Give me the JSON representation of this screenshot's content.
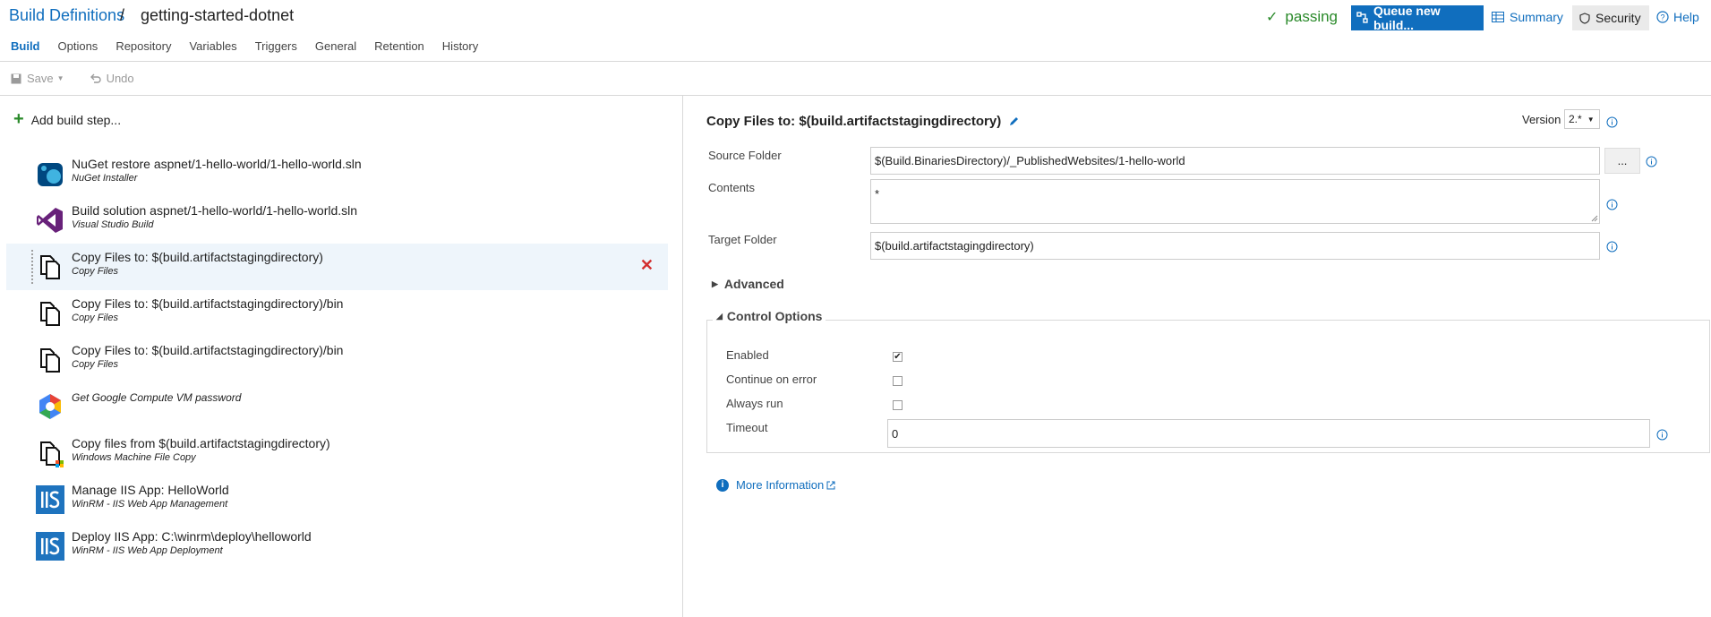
{
  "breadcrumb": {
    "root": "Build Definitions",
    "separator": "/",
    "current": "getting-started-dotnet"
  },
  "header": {
    "status": "passing",
    "queue_button": "Queue new build...",
    "summary": "Summary",
    "security": "Security",
    "help": "Help"
  },
  "tabs": [
    {
      "label": "Build",
      "active": true
    },
    {
      "label": "Options"
    },
    {
      "label": "Repository"
    },
    {
      "label": "Variables"
    },
    {
      "label": "Triggers"
    },
    {
      "label": "General"
    },
    {
      "label": "Retention"
    },
    {
      "label": "History"
    }
  ],
  "toolbar": {
    "save": "Save",
    "undo": "Undo"
  },
  "left": {
    "add_step": "Add build step..."
  },
  "steps": [
    {
      "title": "NuGet restore aspnet/1-hello-world/1-hello-world.sln",
      "sub": "NuGet Installer",
      "icon": "nuget-icon"
    },
    {
      "title": "Build solution aspnet/1-hello-world/1-hello-world.sln",
      "sub": "Visual Studio Build",
      "icon": "visual-studio-icon"
    },
    {
      "title": "Copy Files to: $(build.artifactstagingdirectory)",
      "sub": "Copy Files",
      "icon": "copy-files-icon",
      "selected": true
    },
    {
      "title": "Copy Files to: $(build.artifactstagingdirectory)/bin",
      "sub": "Copy Files",
      "icon": "copy-files-icon"
    },
    {
      "title": "Copy Files to: $(build.artifactstagingdirectory)/bin",
      "sub": "Copy Files",
      "icon": "copy-files-icon"
    },
    {
      "title": "Get Google Compute VM password",
      "sub": "",
      "icon": "google-cloud-icon",
      "title_italic": true
    },
    {
      "title": "Copy files from $(build.artifactstagingdirectory)",
      "sub": "Windows Machine File Copy",
      "icon": "windows-file-copy-icon"
    },
    {
      "title": "Manage IIS App: HelloWorld",
      "sub": "WinRM - IIS Web App Management",
      "icon": "iis-icon"
    },
    {
      "title": "Deploy IIS App: C:\\winrm\\deploy\\helloworld",
      "sub": "WinRM - IIS Web App Deployment",
      "icon": "iis-icon"
    }
  ],
  "task": {
    "title": "Copy Files to: $(build.artifactstagingdirectory)",
    "version_label": "Version",
    "version_value": "2.*",
    "source_folder_label": "Source Folder",
    "source_folder_value": "$(Build.BinariesDirectory)/_PublishedWebsites/1-hello-world",
    "browse_button": "...",
    "contents_label": "Contents",
    "contents_value": "*",
    "target_folder_label": "Target Folder",
    "target_folder_value": "$(build.artifactstagingdirectory)",
    "advanced_label": "Advanced",
    "control_options_label": "Control Options",
    "enabled_label": "Enabled",
    "enabled_checked": true,
    "continue_on_error_label": "Continue on error",
    "continue_on_error_checked": false,
    "always_run_label": "Always run",
    "always_run_checked": false,
    "timeout_label": "Timeout",
    "timeout_value": "0",
    "more_info": "More Information"
  },
  "colors": {
    "accent": "#106ebe",
    "passing": "#2a8a2a",
    "delete": "#d32f2f",
    "selected_row": "#eef5fb"
  }
}
